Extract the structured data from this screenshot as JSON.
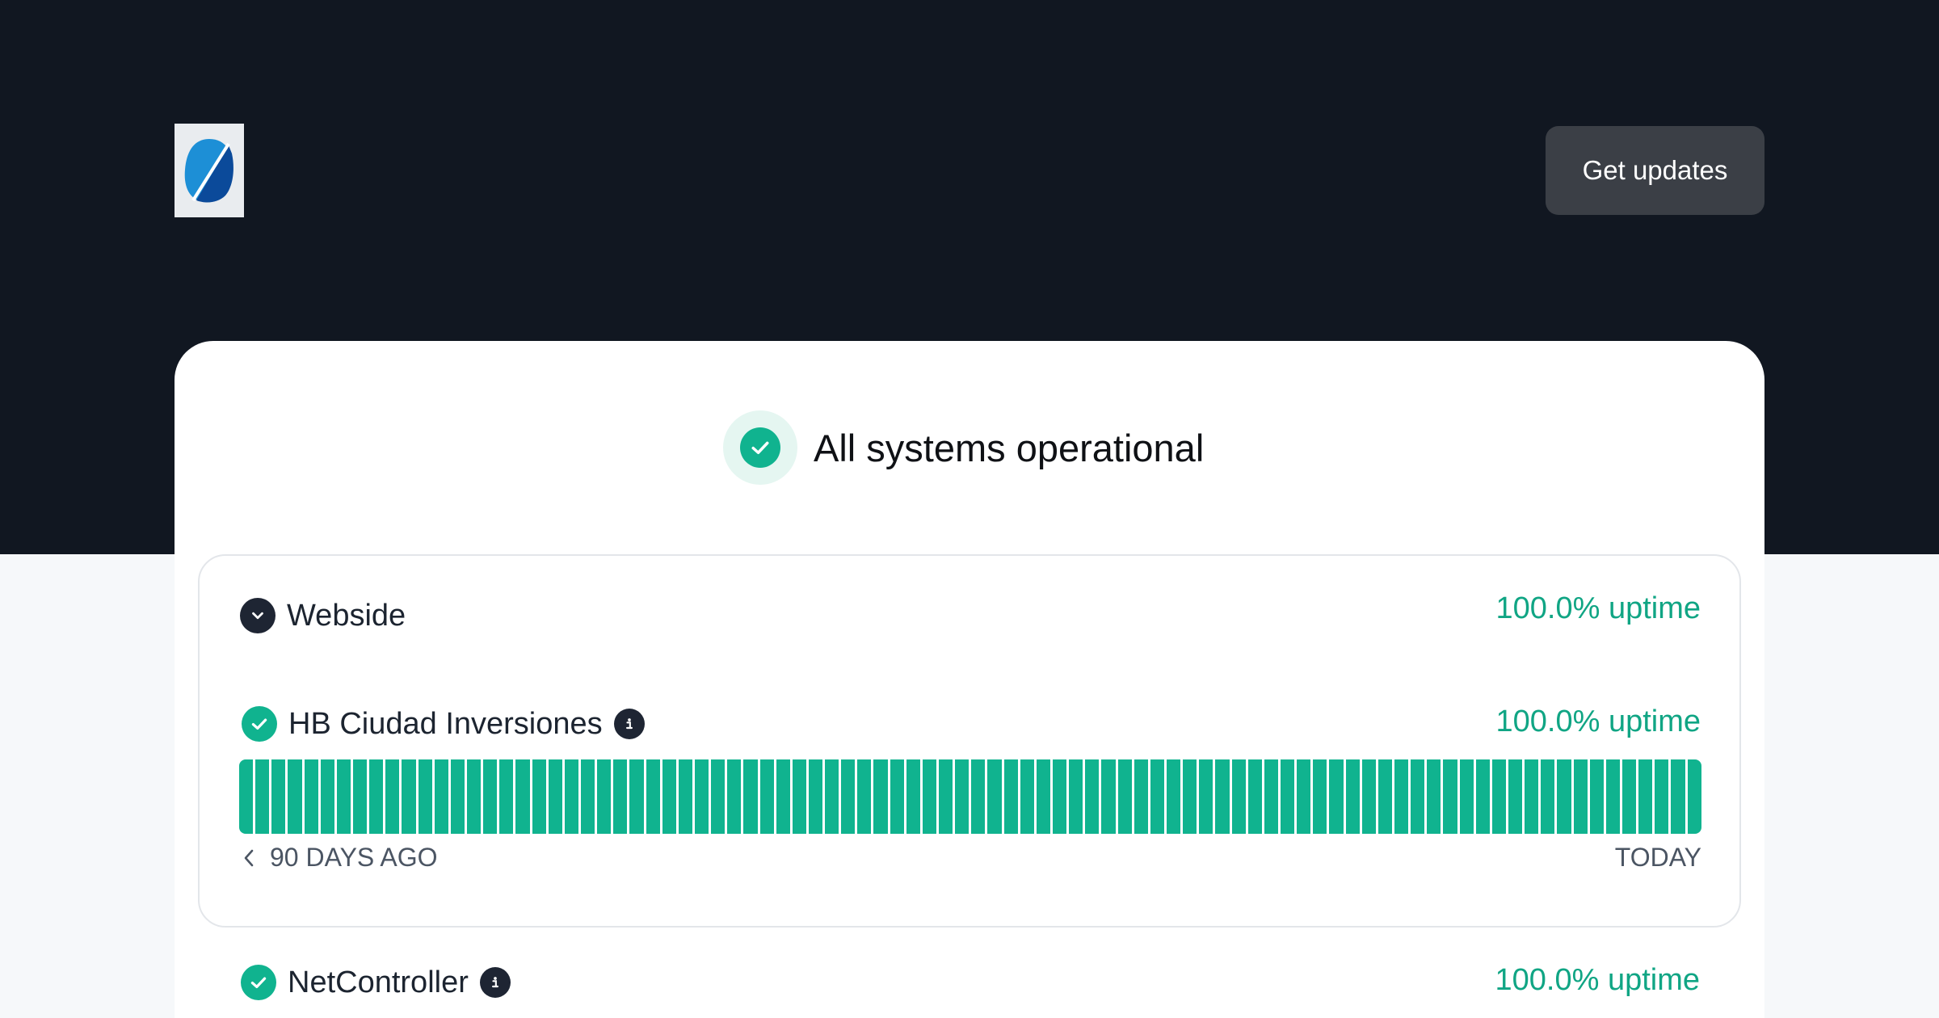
{
  "header": {
    "logo_icon": "company-logo",
    "get_updates_label": "Get updates"
  },
  "status": {
    "icon": "check-circle-icon",
    "text": "All systems operational"
  },
  "components": [
    {
      "name": "Webside",
      "icon": "chevron-down-icon",
      "uptime": "100.0% uptime",
      "expanded": true
    },
    {
      "name": "HB Ciudad Inversiones",
      "icon": "check-circle-icon",
      "info_icon": "info-icon",
      "uptime": "100.0% uptime",
      "days": 90,
      "operational_fraction": 1.0,
      "axis_start": "90 DAYS AGO",
      "axis_end": "TODAY"
    },
    {
      "name": "NetController",
      "icon": "check-circle-icon",
      "info_icon": "info-icon",
      "uptime": "100.0% uptime"
    }
  ],
  "colors": {
    "header_bg": "#111721",
    "operational": "#10b38f",
    "uptime_text": "#10a584",
    "button_bg": "#3b3f46"
  }
}
